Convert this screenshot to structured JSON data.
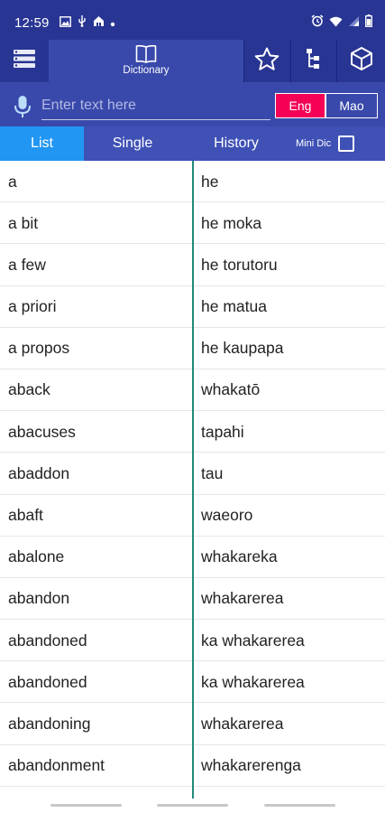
{
  "status_bar": {
    "time": "12:59",
    "left_icons": [
      "image-icon",
      "usb-icon",
      "app-icon",
      "dot-icon"
    ],
    "right_icons": [
      "alarm-icon",
      "wifi-icon",
      "signal-icon",
      "battery-icon"
    ]
  },
  "toolbar": {
    "dictionary_label": "Dictionary",
    "icons": [
      "menu-icon",
      "book-icon",
      "star-icon",
      "hierarchy-icon",
      "cube-icon"
    ]
  },
  "search": {
    "placeholder": "Enter text here",
    "value": ""
  },
  "language": {
    "source": "Eng",
    "target": "Mao",
    "active": "Eng",
    "active_color": "#f50057"
  },
  "tabs": {
    "list": "List",
    "single": "Single",
    "history": "History",
    "mini_dic": "Mini Dic",
    "active": "List",
    "mini_dic_checked": false
  },
  "entries": [
    {
      "en": "a",
      "mi": "he"
    },
    {
      "en": "a bit",
      "mi": "he moka"
    },
    {
      "en": "a few",
      "mi": "he torutoru"
    },
    {
      "en": "a priori",
      "mi": "he matua"
    },
    {
      "en": "a propos",
      "mi": "he kaupapa"
    },
    {
      "en": "aback",
      "mi": "whakatō"
    },
    {
      "en": "abacuses",
      "mi": "tapahi"
    },
    {
      "en": "abaddon",
      "mi": "tau"
    },
    {
      "en": "abaft",
      "mi": "waeoro"
    },
    {
      "en": "abalone",
      "mi": "whakareka"
    },
    {
      "en": "abandon",
      "mi": "whakarerea"
    },
    {
      "en": "abandoned",
      "mi": "ka whakarerea"
    },
    {
      "en": "abandoned",
      "mi": "ka whakarerea"
    },
    {
      "en": "abandoning",
      "mi": "whakarerea"
    },
    {
      "en": "abandonment",
      "mi": "whakarerenga"
    }
  ],
  "colors": {
    "status_bar": "#283593",
    "toolbar": "#283593",
    "search_bar": "#3949ab",
    "tab_bar": "#3f51b5",
    "tab_active": "#2196f3",
    "divider": "#1e8a7a"
  }
}
